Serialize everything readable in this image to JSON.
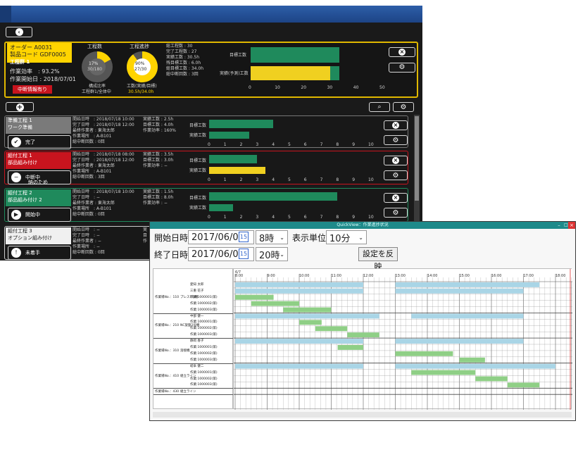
{
  "order": {
    "order_no": "オーダー A0031",
    "product_code": "製品コード GDF0005",
    "group": "工程群 1",
    "efficiency": "作業効率　: 93.2%",
    "start_date": "作業開始日 : 2018/07/01",
    "interrupt_button": "中断情報有り",
    "pie1_title": "工程数",
    "pie1_pct": "17%",
    "pie1_ratio": "30/180",
    "pie1_caption1": "構成比率",
    "pie1_caption2": "工程群1/全体中",
    "pie1_fraction": 0.17,
    "pie2_title": "工程進捗",
    "pie2_pct": "90%",
    "pie2_ratio": "27/30",
    "pie2_caption1": "工数(実績/目標)",
    "pie2_caption2": "30.5h/34.0h",
    "pie2_fraction": 0.9,
    "stats": [
      "総工程数 : 30",
      "完了工程数 : 27",
      "実績工数 : 30.5h",
      "残目標工数 : 6.0h",
      "総目標工数 : 34.0h",
      "総中断回数 : 3回"
    ],
    "chart_label_target": "目標工数",
    "chart_label_actual": "実績(予測)工数",
    "chart_ticks": [
      "0",
      "10",
      "20",
      "30",
      "40",
      "50"
    ],
    "target_value": 34,
    "actual_yellow": 30.5,
    "actual_green": 3.5,
    "axis_max": 50
  },
  "rows": [
    {
      "name": "準備工程 1",
      "sub": "ワーク準備",
      "tag_color": "#7a7a7a",
      "border": "#777777",
      "status": "完了",
      "status_icon": "✔",
      "left": [
        "開始日時　: 2018/07/18 10:00",
        "完了日時　: 2018/07/18 12:00",
        "最終作業者 : 東海太郎",
        "作業場所　: A-B101",
        "総中断回数 : 0回"
      ],
      "right": [
        "実績工数 : 2.5h",
        "目標工数 : 4.0h",
        "作業効率 : 160%"
      ],
      "target": 4.0,
      "actual": 2.5,
      "actual_color": "#1f8a5c"
    },
    {
      "name": "組付工程 1",
      "sub": "部品組み付け",
      "tag_color": "#c8141e",
      "border": "#c8141e",
      "status": "中断中",
      "status2": "納のため",
      "status_icon": "−",
      "left": [
        "開始日時　: 2018/07/18 08:00",
        "完了日時　: 2018/07/18 12:00",
        "最終作業者 : 東海太郎",
        "作業場所　: A-B101",
        "総中断回数 : 3回"
      ],
      "right": [
        "実績工数 : 3.5h",
        "目標工数 : 3.0h",
        "作業効率 : −"
      ],
      "target": 3.0,
      "actual": 3.5,
      "actual_color": "#f0d020"
    },
    {
      "name": "組付工程 2",
      "sub": "部品組み付け 2",
      "tag_color": "#1f8a5c",
      "border": "#1f8a5c",
      "status": "開始中",
      "status_icon": "▶",
      "left": [
        "開始日時　: 2018/07/18 10:00",
        "完了日時　: −",
        "最終作業者 : 東海太郎",
        "作業場所　: A-B101",
        "総中断回数 : 0回"
      ],
      "right": [
        "実績工数 : 1.5h",
        "目標工数 : 8.0h",
        "作業効率 : −"
      ],
      "target": 8.0,
      "actual": 1.5,
      "actual_color": "#1f8a5c"
    },
    {
      "name": "組付工程 3",
      "sub": "オプション組み付け",
      "tag_color": "#f0f0f0",
      "border": "#cccccc",
      "status": "未着手",
      "status_icon": "!",
      "left": [
        "開始日時　: −",
        "完了日時　: −",
        "最終作業者 : −",
        "作業場所　: −",
        "総中断回数 : 0回"
      ],
      "right": [
        "実",
        "目",
        "作"
      ],
      "target": 0,
      "actual": 0,
      "actual_color": "#1f8a5c"
    }
  ],
  "mini_axis": [
    "0",
    "1",
    "2",
    "3",
    "4",
    "5",
    "6",
    "7",
    "8",
    "9",
    "10"
  ],
  "mini_target_label": "目標工数",
  "mini_actual_label": "実績工数",
  "quickview": {
    "title": "QuickView：作業進捗状況",
    "start_label": "開始日時",
    "end_label": "終了日時",
    "start_date": "2017/06/07",
    "end_date": "2017/06/07",
    "cal_day": "15",
    "start_hour": "8時",
    "end_hour": "20時",
    "unit_label": "表示単位",
    "unit_value": "10分",
    "apply_button": "設定を反映",
    "date_label": "6/7",
    "hours": [
      "8:00",
      "9:00",
      "10:00",
      "11:00",
      "12:00",
      "13:00",
      "14:00",
      "15:00",
      "16:00",
      "17:00",
      "18:00"
    ],
    "groups": [
      {
        "label": "作業場No.：110",
        "name": "プレス1号機",
        "rows": [
          "愛知 太郎",
          "三重 花子",
          "作業:1000001(第)",
          "作業:1000002(第)",
          "作業:1000003(第)"
        ]
      },
      {
        "label": "作業場No.：210",
        "name": "NC旋盤2号機",
        "rows": [
          "中部 健一",
          "作業:1000001(第)",
          "作業:1000002(第)",
          "作業:1000003(第)"
        ]
      },
      {
        "label": "作業場No.：310",
        "name": "溶接機",
        "rows": [
          "静岡 春子",
          "作業:1000001(第)",
          "作業:1000002(第)",
          "作業:1000003(第)"
        ]
      },
      {
        "label": "作業場No.：410",
        "name": "組立ライン",
        "rows": [
          "岐阜 健二",
          "作業:1000001(第)",
          "作業:1000002(第)",
          "作業:1000003(第)"
        ]
      },
      {
        "label": "作業場No.：430",
        "name": "組立ライン",
        "rows": []
      }
    ]
  },
  "colors": {
    "dark_bg": "#1a1a1a",
    "yellow": "#ffd400",
    "green": "#1f8a5c",
    "red": "#c8141e",
    "gantt_blue": "#a9d5e6",
    "gantt_green": "#8fcf86",
    "teal": "#1e8a8a"
  }
}
